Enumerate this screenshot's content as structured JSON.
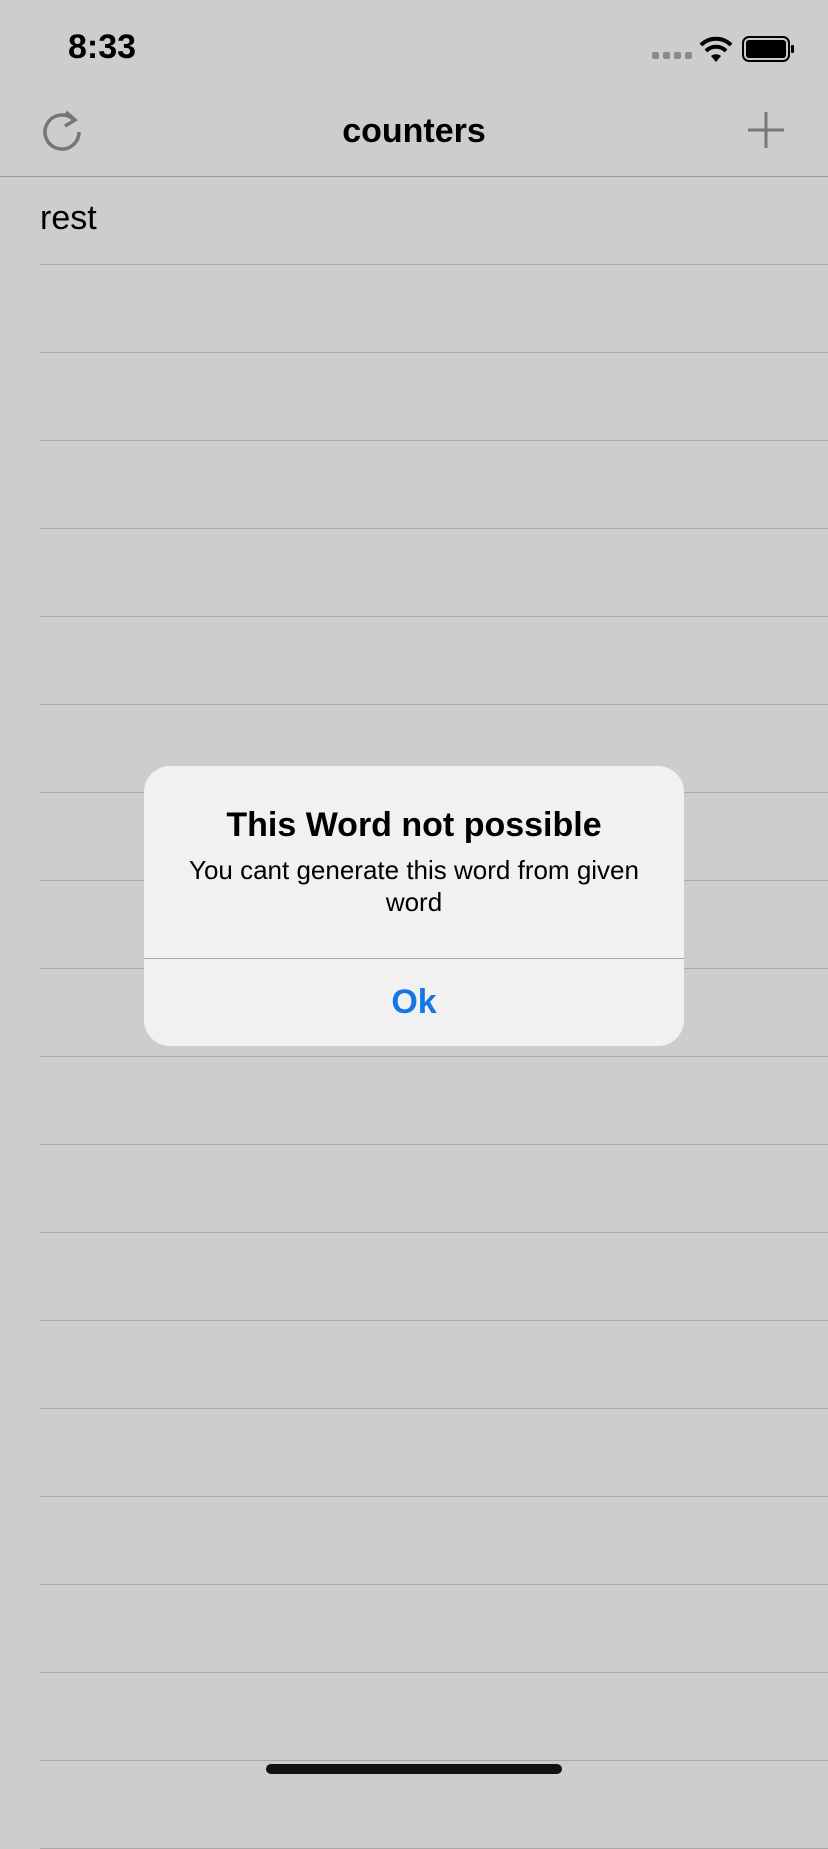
{
  "status_bar": {
    "time": "8:33"
  },
  "nav": {
    "title": "counters"
  },
  "list": {
    "rows": [
      "rest",
      "",
      "",
      "",
      "",
      "",
      "",
      "",
      "",
      "",
      "",
      "",
      "",
      "",
      "",
      "",
      "",
      "",
      ""
    ]
  },
  "alert": {
    "title": "This Word not possible",
    "message": "You cant generate this word from given word",
    "button_label": "Ok"
  },
  "colors": {
    "background": "#cdcdcd",
    "alert_bg": "#f1f1f1",
    "accent": "#1477e6"
  },
  "icons": {
    "left_nav": "refresh-icon",
    "right_nav": "plus-icon"
  }
}
